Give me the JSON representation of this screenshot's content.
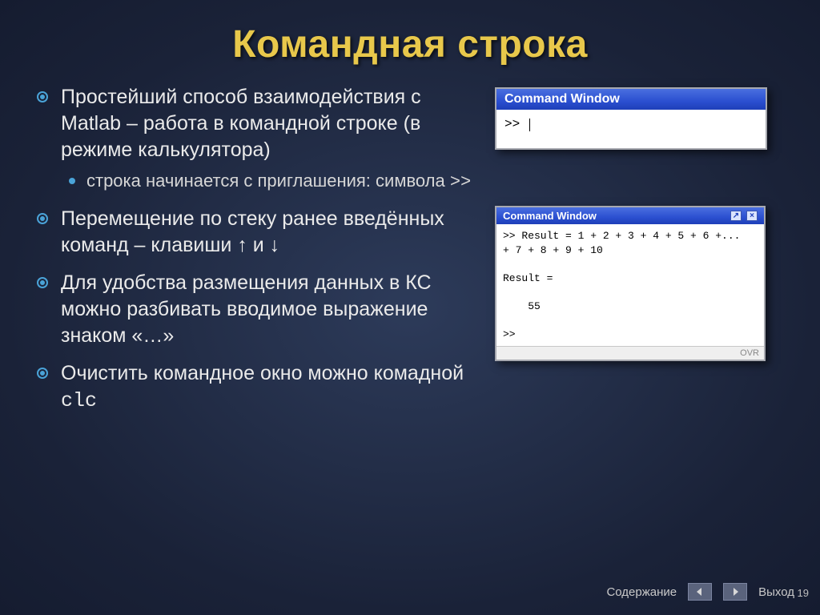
{
  "title": "Командная строка",
  "bullets": [
    {
      "text": "Простейший способ взаимодействия с Matlab – работа в командной строке (в режиме калькулятора)",
      "sub": [
        {
          "text_prefix": "строка начинается с приглашения: символа ",
          "code": ">>"
        }
      ]
    },
    {
      "text": "Перемещение по стеку ранее введённых команд – клавиши ↑ и ↓"
    },
    {
      "text": "Для удобства размещения данных в КС можно разбивать вводимое выражение знаком «…»"
    },
    {
      "text_prefix": "Очистить командное окно можно комадной ",
      "code": "clc"
    }
  ],
  "cmd1": {
    "title": "Command Window",
    "prompt": ">> "
  },
  "cmd2": {
    "title": "Command Window",
    "lines": ">> Result = 1 + 2 + 3 + 4 + 5 + 6 +...\n+ 7 + 8 + 9 + 10\n\nResult =\n\n    55\n\n>>",
    "status": "OVR"
  },
  "footer": {
    "toc": "Содержание",
    "exit": "Выход"
  },
  "page": "19"
}
